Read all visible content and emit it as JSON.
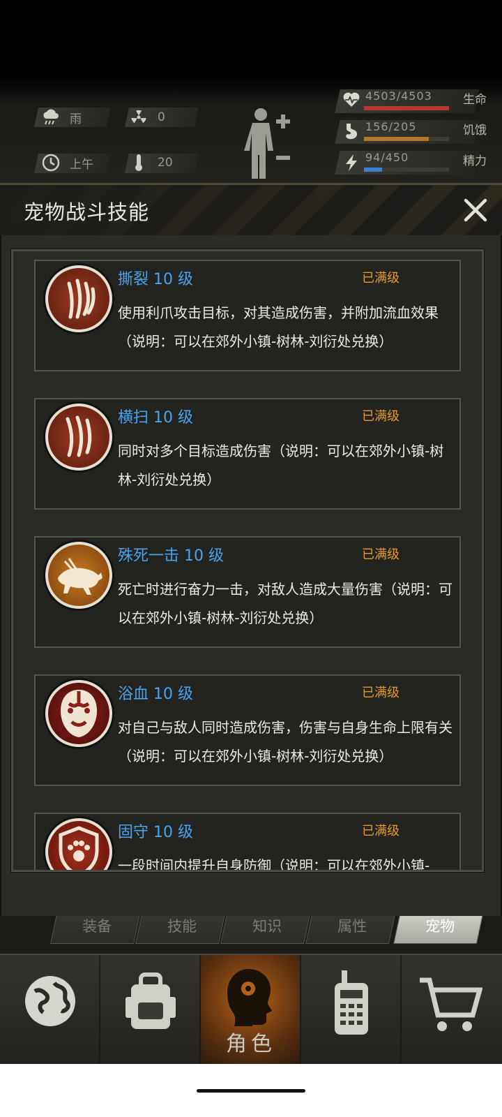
{
  "status": {
    "weather": "雨",
    "radiation": "0",
    "time_of_day": "上午",
    "temperature": "20"
  },
  "vitals": [
    {
      "value": "4503/4503",
      "label": "生命",
      "fraction": 1.0,
      "color": "#b23a32",
      "icon": "heart-icon"
    },
    {
      "value": "156/205",
      "label": "饥饿",
      "fraction": 0.76,
      "color": "#b3762d",
      "icon": "stomach-icon"
    },
    {
      "value": "94/450",
      "label": "精力",
      "fraction": 0.21,
      "color": "#3d7fd0",
      "icon": "lightning-icon"
    }
  ],
  "panel": {
    "title": "宠物战斗技能"
  },
  "skills": [
    {
      "name": "撕裂 10 级",
      "status": "已满级",
      "desc": "使用利爪攻击目标，对其造成伤害，并附加流血效果（说明：可以在郊外小镇-树林-刘衍处兑换）",
      "icon": "claw-slash-icon"
    },
    {
      "name": "横扫 10 级",
      "status": "已满级",
      "desc": "同时对多个目标造成伤害（说明：可以在郊外小镇-树林-刘衍处兑换）",
      "icon": "claw-sweep-icon"
    },
    {
      "name": "殊死一击 10 级",
      "status": "已满级",
      "desc": "死亡时进行奋力一击，对敌人造成大量伤害（说明：可以在郊外小镇-树林-刘衍处兑换）",
      "icon": "charging-beast-icon"
    },
    {
      "name": "浴血 10 级",
      "status": "已满级",
      "desc": "对自己与敌人同时造成伤害，伤害与自身生命上限有关（说明：可以在郊外小镇-树林-刘衍处兑换）",
      "icon": "bloody-face-icon"
    },
    {
      "name": "固守 10 级",
      "status": "已满级",
      "desc": "一段时间内提升自身防御（说明：可以在郊外小镇-",
      "icon": "paw-shield-icon"
    }
  ],
  "sub_tabs": [
    "装备",
    "技能",
    "知识",
    "属性",
    "宠物"
  ],
  "nav": {
    "active_label": "角色"
  },
  "colors": {
    "skill_name": "#4aa3ef",
    "max_level": "#e69a2a"
  }
}
